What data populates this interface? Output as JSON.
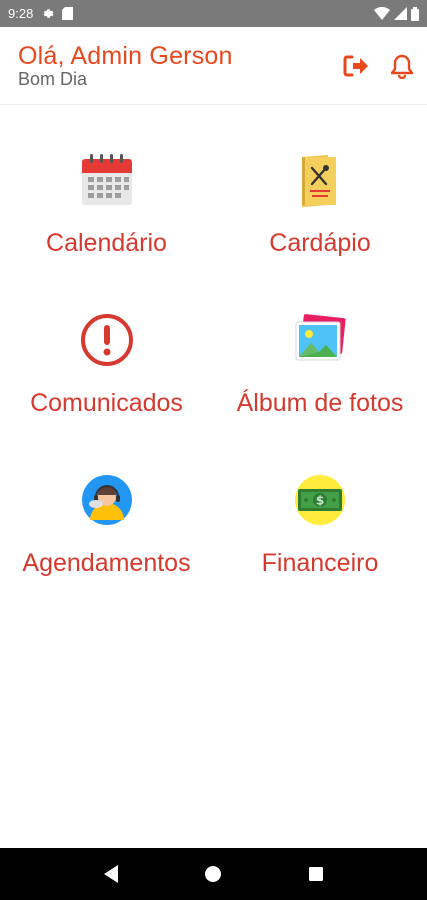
{
  "status_bar": {
    "time": "9:28",
    "left_icons": [
      "gear-icon",
      "sd-card-icon"
    ],
    "right_icons": [
      "wifi-icon",
      "signal-icon",
      "battery-icon"
    ]
  },
  "header": {
    "greeting": "Olá, Admin Gerson",
    "subgreeting": "Bom Dia",
    "actions": [
      "logout-icon",
      "bell-icon"
    ]
  },
  "menu": {
    "items": [
      {
        "label": "Calendário",
        "icon": "calendar-icon"
      },
      {
        "label": "Cardápio",
        "icon": "menu-card-icon"
      },
      {
        "label": "Comunicados",
        "icon": "alert-icon"
      },
      {
        "label": "Álbum de fotos",
        "icon": "photo-album-icon"
      },
      {
        "label": "Agendamentos",
        "icon": "support-agent-icon"
      },
      {
        "label": "Financeiro",
        "icon": "money-icon"
      }
    ]
  },
  "colors": {
    "accent": "#e8481c",
    "label": "#d63a2f",
    "status_bar": "#7a7a7a",
    "nav_bar": "#000000"
  },
  "nav_bar": {
    "buttons": [
      "back-icon",
      "home-icon",
      "recents-icon"
    ]
  }
}
